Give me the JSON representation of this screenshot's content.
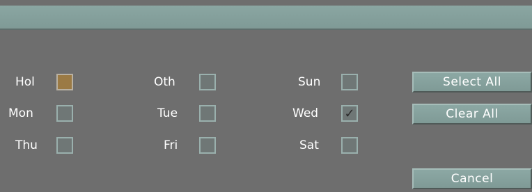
{
  "days": [
    {
      "label": "Hol",
      "checked": false,
      "highlighted": true
    },
    {
      "label": "Oth",
      "checked": false
    },
    {
      "label": "Sun",
      "checked": false
    },
    {
      "label": "Mon",
      "checked": false
    },
    {
      "label": "Tue",
      "checked": false
    },
    {
      "label": "Wed",
      "checked": true
    },
    {
      "label": "Thu",
      "checked": false
    },
    {
      "label": "Fri",
      "checked": false
    },
    {
      "label": "Sat",
      "checked": false
    }
  ],
  "buttons": {
    "select_all": "Select All",
    "clear_all": "Clear All",
    "cancel": "Cancel"
  },
  "check_glyph": "✓",
  "colors": {
    "background": "#6e6e6e",
    "titlebar": "#8aa6a2",
    "hol_checkbox": "#9b7a44"
  }
}
